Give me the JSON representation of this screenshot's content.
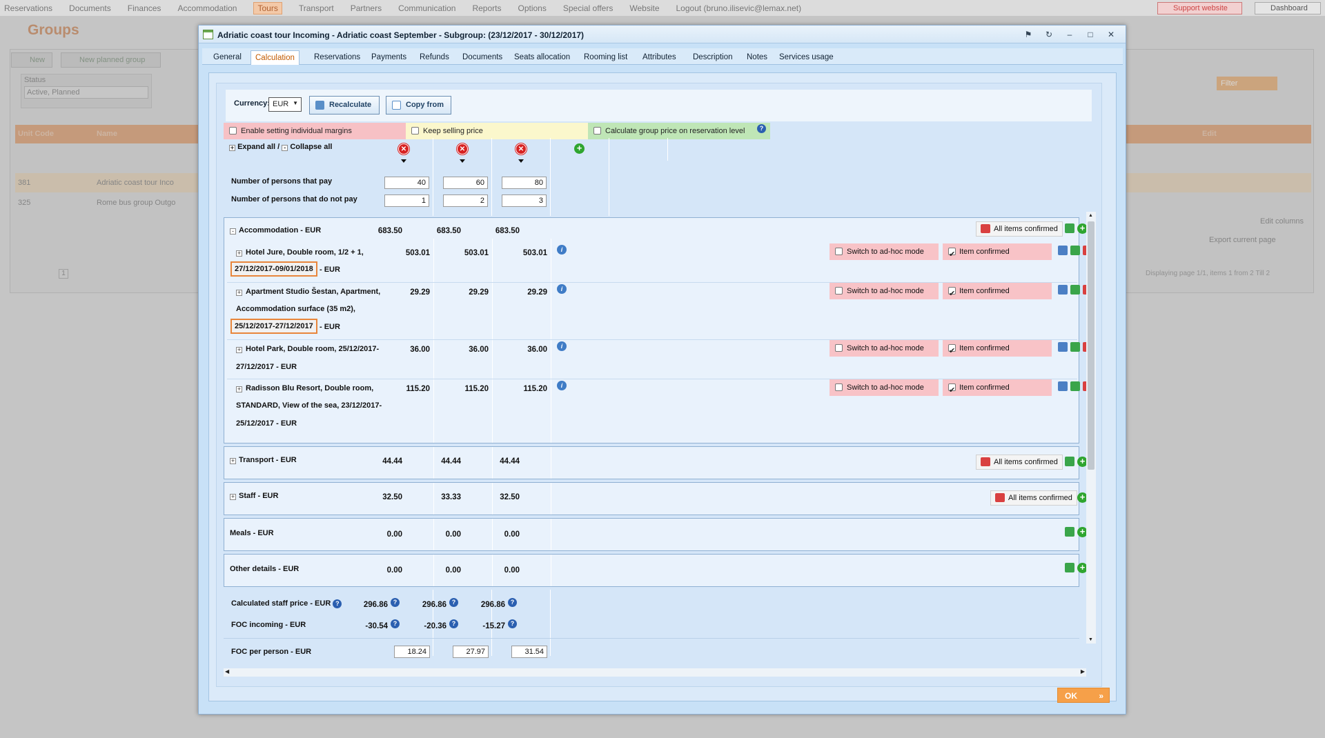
{
  "topnav": {
    "items": [
      "Reservations",
      "Documents",
      "Finances",
      "Accommodation",
      "Tours",
      "Transport",
      "Partners",
      "Communication",
      "Reports",
      "Options",
      "Special offers",
      "Website",
      "Logout (bruno.ilisevic@lemax.net)"
    ],
    "active": "Tours",
    "support": "Support website",
    "dashboard": "Dashboard"
  },
  "background": {
    "title": "Groups",
    "new_button": "New",
    "new_planned_button": "New planned group",
    "status_label": "Status",
    "status_value": "Active, Planned",
    "filter_button": "Filter",
    "table_headers": {
      "unit_code": "Unit Code",
      "name": "Name",
      "edit": "Edit"
    },
    "rows": [
      {
        "code": "381",
        "name": "Adriatic coast tour Inco"
      },
      {
        "code": "325",
        "name": "Rome bus group Outgo"
      }
    ],
    "edit_columns": "Edit columns",
    "export": "Export current page",
    "pager_current": "1",
    "pager_info": "Displaying page 1/1, items 1 from 2 Till 2"
  },
  "modal": {
    "title": "Adriatic coast tour Incoming - Adriatic coast September - Subgroup: (23/12/2017 - 30/12/2017)",
    "tabs": [
      "General",
      "Calculation",
      "Reservations",
      "Payments",
      "Refunds",
      "Documents",
      "Seats allocation",
      "Rooming list",
      "Attributes",
      "Description",
      "Notes",
      "Services usage"
    ],
    "active_tab": "Calculation",
    "currency_label": "Currency:",
    "currency_value": "EUR",
    "recalculate": "Recalculate",
    "copy_from": "Copy from",
    "opt_margins": "Enable setting individual margins",
    "opt_keep": "Keep selling price",
    "opt_group": "Calculate group price on reservation level",
    "expand_all": "Expand all /",
    "collapse_all": "Collapse all",
    "persons_pay_label": "Number of persons that pay",
    "persons_pay": [
      "40",
      "60",
      "80"
    ],
    "persons_nopay_label": "Number of persons that do not pay",
    "persons_nopay": [
      "1",
      "2",
      "3"
    ],
    "all_items_confirmed": "All items confirmed",
    "switch_adhoc": "Switch to ad-hoc mode",
    "item_confirmed": "Item confirmed",
    "accommodation": {
      "label": "Accommodation - EUR",
      "totals": [
        "683.50",
        "683.50",
        "683.50"
      ],
      "items": [
        {
          "line1": "Hotel Jure, Double room, 1/2 + 1,",
          "date": "27/12/2017-09/01/2018",
          "suffix": "- EUR",
          "values": [
            "503.01",
            "503.01",
            "503.01"
          ]
        },
        {
          "line1": "Apartment Studio Šestan, Apartment,",
          "line2": "Accommodation surface (35 m2),",
          "date": "25/12/2017-27/12/2017",
          "suffix": "- EUR",
          "values": [
            "29.29",
            "29.29",
            "29.29"
          ]
        },
        {
          "line1": "Hotel Park, Double room, 25/12/2017-",
          "line2": "27/12/2017 - EUR",
          "values": [
            "36.00",
            "36.00",
            "36.00"
          ]
        },
        {
          "line1": "Radisson Blu Resort, Double room,",
          "line2": "STANDARD, View of the sea, 23/12/2017-",
          "line3": "25/12/2017 - EUR",
          "values": [
            "115.20",
            "115.20",
            "115.20"
          ]
        }
      ]
    },
    "transport": {
      "label": "Transport - EUR",
      "values": [
        "44.44",
        "44.44",
        "44.44"
      ]
    },
    "staff": {
      "label": "Staff - EUR",
      "values": [
        "32.50",
        "33.33",
        "32.50"
      ]
    },
    "meals": {
      "label": "Meals - EUR",
      "values": [
        "0.00",
        "0.00",
        "0.00"
      ]
    },
    "other": {
      "label": "Other details - EUR",
      "values": [
        "0.00",
        "0.00",
        "0.00"
      ]
    },
    "calc_staff": {
      "label": "Calculated staff price - EUR",
      "values": [
        "296.86",
        "296.86",
        "296.86"
      ]
    },
    "foc_incoming": {
      "label": "FOC incoming - EUR",
      "values": [
        "-30.54",
        "-20.36",
        "-15.27"
      ]
    },
    "foc_per_person": {
      "label": "FOC per person - EUR",
      "values": [
        "18.24",
        "27.97",
        "31.54"
      ]
    },
    "ok": "OK"
  }
}
